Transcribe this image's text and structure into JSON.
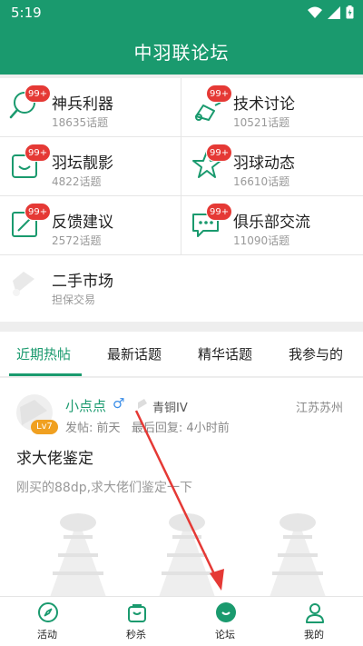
{
  "status_bar": {
    "time": "5:19"
  },
  "app_bar": {
    "title": "中羽联论坛"
  },
  "forums": [
    {
      "name": "神兵利器",
      "count": "18635话题",
      "badge": "99+",
      "icon": "search-shuttle-icon"
    },
    {
      "name": "技术讨论",
      "count": "10521话题",
      "badge": "99+",
      "icon": "badminton-hit-icon"
    },
    {
      "name": "羽坛靓影",
      "count": "4822话题",
      "badge": "99+",
      "icon": "photo-frame-icon"
    },
    {
      "name": "羽球动态",
      "count": "16610话题",
      "badge": "99+",
      "icon": "star-icon"
    },
    {
      "name": "反馈建议",
      "count": "2572话题",
      "badge": "99+",
      "icon": "feedback-edit-icon"
    },
    {
      "name": "俱乐部交流",
      "count": "11090话题",
      "badge": "99+",
      "icon": "chat-icon"
    },
    {
      "name": "二手市场",
      "count": "担保交易",
      "badge": "",
      "icon": "shuttlecock-icon"
    }
  ],
  "tabs": [
    "近期热帖",
    "最新话题",
    "精华话题",
    "我参与的"
  ],
  "active_tab": "近期热帖",
  "post": {
    "username": "小点点",
    "gender": "♂",
    "rank": "青铜IV",
    "level": "Lv7",
    "location": "江苏苏州",
    "meta": "发帖: 前天   最后回复: 4小时前",
    "title": "求大佬鉴定",
    "body": "刚买的88dp,求大佬们鉴定一下"
  },
  "bottom_nav": [
    {
      "label": "活动",
      "icon": "compass-icon"
    },
    {
      "label": "秒杀",
      "icon": "shopping-bag-icon"
    },
    {
      "label": "论坛",
      "icon": "forum-icon"
    },
    {
      "label": "我的",
      "icon": "user-icon"
    }
  ],
  "colors": {
    "primary": "#1a9a6e",
    "badge": "#e53935",
    "arrow": "#e53935",
    "level": "#f0a020"
  }
}
